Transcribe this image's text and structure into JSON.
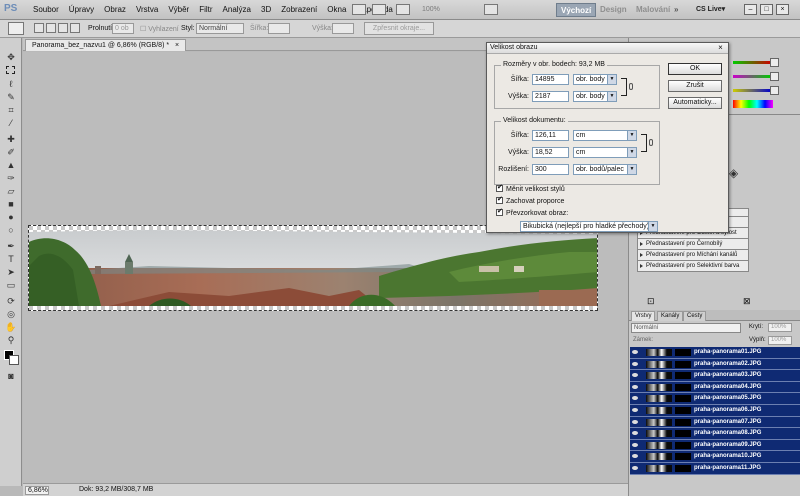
{
  "app": {
    "logo": "PS"
  },
  "menu": [
    "Soubor",
    "Úpravy",
    "Obraz",
    "Vrstva",
    "Výběr",
    "Filtr",
    "Analýza",
    "3D",
    "Zobrazení",
    "Okna",
    "Nápověda"
  ],
  "menubar": {
    "zoom": "100%",
    "workspaces": [
      "Výchozí",
      "Design",
      "Malování"
    ],
    "more": "»",
    "cs_live": "CS Live▾"
  },
  "options_bar": {
    "feather_label": "Prolnutí:",
    "feather_value": "0 ob",
    "antialias_label": "Vyhlazení",
    "style_label": "Styl:",
    "style_value": "Normální",
    "width_label": "Šířka:",
    "height_label": "Výška:",
    "refine_button": "Zpřesnit okraje..."
  },
  "document": {
    "tab_title": "Panorama_bez_nazvu1 @ 6,86% (RGB/8) *",
    "tab_close": "×",
    "status_zoom": "6,86%",
    "status_doc": "Dok: 93,2 MB/308,7 MB"
  },
  "dialog": {
    "title": "Velikost obrazu",
    "close": "×",
    "pixel_dims": {
      "title": "Rozměry v obr. bodech:  93,2 MB",
      "width_label": "Šířka:",
      "width_value": "14895",
      "width_unit": "obr. body",
      "height_label": "Výška:",
      "height_value": "2187",
      "height_unit": "obr. body"
    },
    "doc_size": {
      "title": "Velikost dokumentu:",
      "width_label": "Šířka:",
      "width_value": "126,11",
      "width_unit": "cm",
      "height_label": "Výška:",
      "height_value": "18,52",
      "height_unit": "cm",
      "resolution_label": "Rozlišení:",
      "resolution_value": "300",
      "resolution_unit": "obr. bodů/palec"
    },
    "checkboxes": {
      "scale_styles": "Měnit velikost stylů",
      "constrain": "Zachovat proporce",
      "resample": "Převzorkovat obraz:"
    },
    "resample_method": "Bikubická (nejlepší pro hladké přechody)",
    "buttons": {
      "ok": "OK",
      "cancel": "Zrušit",
      "auto": "Automaticky..."
    }
  },
  "adjustments": [
    "Přednastavení pro Expozice",
    "Přednastavení pro Odstín a sytost",
    "Přednastavení pro Černobílý",
    "Přednastavení pro Míchání kanálů",
    "Přednastavení pro Selektivní barva"
  ],
  "layers_panel": {
    "tabs": [
      "Vrstvy",
      "Kanály",
      "Cesty"
    ],
    "blend_mode": "Normální",
    "opacity_label": "Krytí:",
    "opacity_value": "100%",
    "lock_label": "Zámek:",
    "fill_label": "Výplň:",
    "fill_value": "100%",
    "layers": [
      "praha-panorama01.JPG",
      "praha-panorama02.JPG",
      "praha-panorama03.JPG",
      "praha-panorama04.JPG",
      "praha-panorama05.JPG",
      "praha-panorama06.JPG",
      "praha-panorama07.JPG",
      "praha-panorama08.JPG",
      "praha-panorama09.JPG",
      "praha-panorama10.JPG",
      "praha-panorama11.JPG"
    ]
  }
}
